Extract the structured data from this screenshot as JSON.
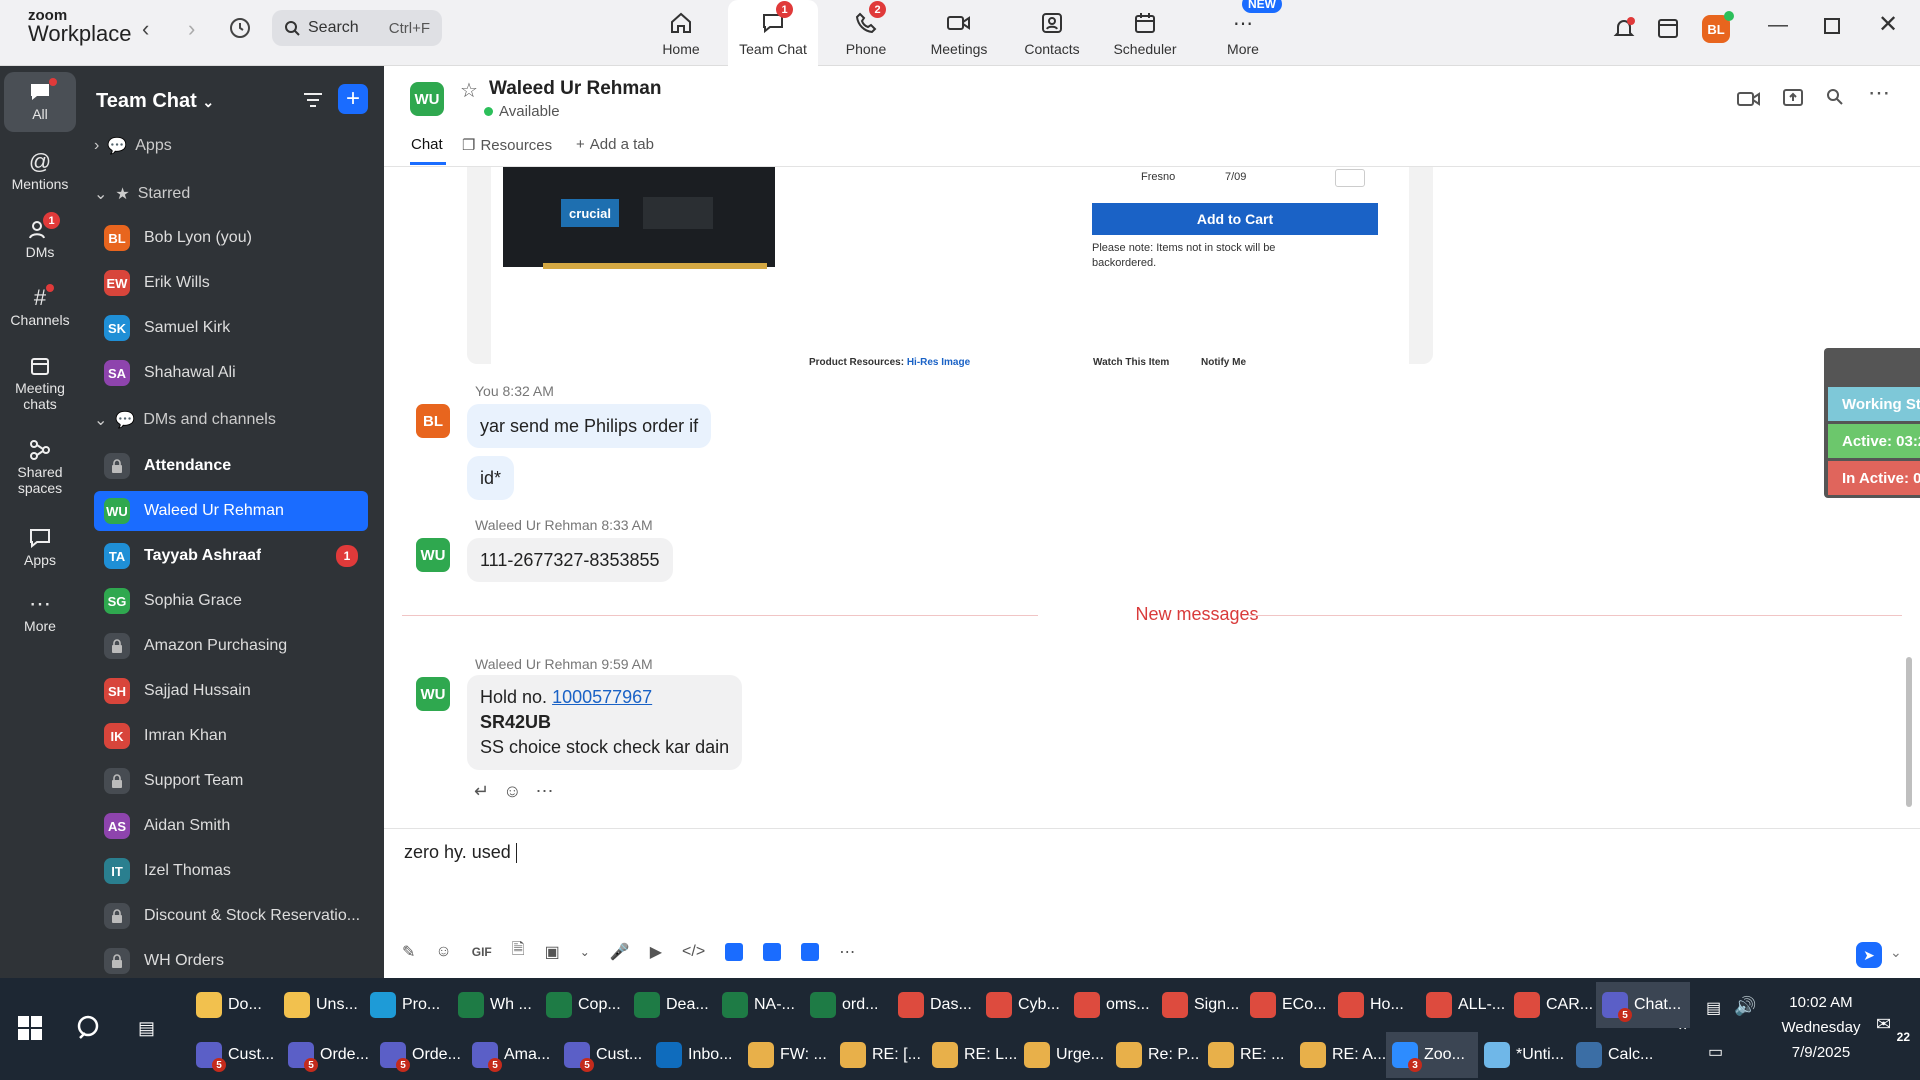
{
  "app": {
    "brand_top": "zoom",
    "brand_bottom": "Workplace"
  },
  "search": {
    "label": "Search",
    "shortcut": "Ctrl+F"
  },
  "nav_tabs": [
    {
      "label": "Home",
      "icon": "home-icon",
      "badge": ""
    },
    {
      "label": "Team Chat",
      "icon": "chat-icon",
      "badge": "1"
    },
    {
      "label": "Phone",
      "icon": "phone-icon",
      "badge": "2"
    },
    {
      "label": "Meetings",
      "icon": "video-icon",
      "badge": ""
    },
    {
      "label": "Contacts",
      "icon": "contacts-icon",
      "badge": ""
    },
    {
      "label": "Scheduler",
      "icon": "calendar-icon",
      "badge": ""
    },
    {
      "label": "More",
      "icon": "more-icon",
      "badge": "NEW"
    }
  ],
  "user_avatar": "BL",
  "rail": [
    {
      "label": "All",
      "icon": "chat-bubble-icon"
    },
    {
      "label": "Mentions",
      "icon": "at-icon"
    },
    {
      "label": "DMs",
      "icon": "people-icon",
      "badge": "1"
    },
    {
      "label": "Channels",
      "icon": "hash-icon"
    },
    {
      "label": "Meeting chats",
      "icon": "calendar-icon"
    },
    {
      "label": "Shared spaces",
      "icon": "share-icon"
    },
    {
      "label": "Apps",
      "icon": "apps-icon"
    },
    {
      "label": "More",
      "icon": "more-icon"
    }
  ],
  "sidebar": {
    "title": "Team Chat",
    "apps_label": "Apps",
    "starred_label": "Starred",
    "dms_label": "DMs and channels",
    "starred": [
      {
        "initials": "BL",
        "name": "Bob Lyon (you)",
        "color": "#e8651e"
      },
      {
        "initials": "EW",
        "name": "Erik Wills",
        "color": "#d8453b"
      },
      {
        "initials": "SK",
        "name": "Samuel Kirk",
        "color": "#1f8fd6"
      },
      {
        "initials": "SA",
        "name": "Shahawal Ali",
        "color": "#8e44ad"
      }
    ],
    "channels": [
      {
        "initials": "",
        "name": "Attendance",
        "lock": true,
        "bold": true
      },
      {
        "initials": "WU",
        "name": "Waleed Ur Rehman",
        "color": "#2fa84f",
        "selected": true
      },
      {
        "initials": "TA",
        "name": "Tayyab Ashraaf",
        "color": "#1f8fd6",
        "bold": true,
        "count": "1"
      },
      {
        "initials": "SG",
        "name": "Sophia Grace",
        "color": "#2fa84f"
      },
      {
        "initials": "",
        "name": "Amazon Purchasing",
        "lock": true
      },
      {
        "initials": "SH",
        "name": "Sajjad Hussain",
        "color": "#d8453b"
      },
      {
        "initials": "IK",
        "name": "Imran Khan",
        "color": "#d8453b"
      },
      {
        "initials": "",
        "name": "Support Team",
        "lock": true
      },
      {
        "initials": "AS",
        "name": "Aidan Smith",
        "color": "#8e44ad"
      },
      {
        "initials": "IT",
        "name": "Izel Thomas",
        "color": "#2a7f8f"
      },
      {
        "initials": "",
        "name": "Discount & Stock Reservatio...",
        "lock": true
      },
      {
        "initials": "",
        "name": "WH Orders",
        "lock": true
      }
    ]
  },
  "conversation": {
    "initials": "WU",
    "name": "Waleed Ur Rehman",
    "status": "Available",
    "tabs": [
      "Chat",
      "Resources",
      "Add a tab"
    ]
  },
  "preview": {
    "location": "Fresno",
    "date": "7/09",
    "add_to_cart": "Add to Cart",
    "note": "Please note: Items not in stock will be backordered.",
    "brand": "crucial",
    "resources": "Product Resources:",
    "hires": "Hi-Res Image",
    "watch": "Watch This Item",
    "notify": "Notify Me"
  },
  "messages": [
    {
      "sender": "You",
      "time": "8:32 AM",
      "initials": "BL",
      "lines": [
        "yar send me Philips order if",
        "id*"
      ]
    },
    {
      "sender": "Waleed Ur Rehman",
      "time": "8:33 AM",
      "initials": "WU",
      "lines": [
        "111-2677327-8353855"
      ]
    },
    {
      "sender": "Waleed Ur Rehman",
      "time": "9:59 AM",
      "initials": "WU",
      "hold_prefix": "Hold no.",
      "hold_link": "1000577967",
      "bold_line": "SR42UB",
      "last_line": "SS choice stock check kar dain"
    }
  ],
  "new_messages_label": "New messages",
  "composer": {
    "text": "zero hy. used "
  },
  "status_widget": [
    {
      "label": "Working St",
      "color": "#7ec8d8"
    },
    {
      "label": "Active: 03:2",
      "color": "#6cc76c"
    },
    {
      "label": "In Active: 0",
      "color": "#e0655c"
    }
  ],
  "taskbar": {
    "row1": [
      {
        "label": "Do...",
        "icon": "folder-icon",
        "color": "#f2c14e"
      },
      {
        "label": "Uns...",
        "icon": "folder-icon",
        "color": "#f2c14e"
      },
      {
        "label": "Pro...",
        "icon": "edge-icon",
        "color": "#1e9bd7"
      },
      {
        "label": "Wh ...",
        "icon": "excel-icon",
        "color": "#1e7b45"
      },
      {
        "label": "Cop...",
        "icon": "excel-icon",
        "color": "#1e7b45"
      },
      {
        "label": "Dea...",
        "icon": "excel-icon",
        "color": "#1e7b45"
      },
      {
        "label": "NA-...",
        "icon": "excel-icon",
        "color": "#1e7b45"
      },
      {
        "label": "ord...",
        "icon": "excel-icon",
        "color": "#1e7b45"
      },
      {
        "label": "Das...",
        "icon": "chrome-icon",
        "color": "#dd4b3e"
      },
      {
        "label": "Cyb...",
        "icon": "chrome-icon",
        "color": "#dd4b3e"
      },
      {
        "label": "oms...",
        "icon": "chrome-icon",
        "color": "#dd4b3e"
      },
      {
        "label": "Sign...",
        "icon": "chrome-icon",
        "color": "#dd4b3e"
      },
      {
        "label": "ECo...",
        "icon": "chrome-icon",
        "color": "#dd4b3e"
      },
      {
        "label": "Ho...",
        "icon": "chrome-icon",
        "color": "#dd4b3e"
      },
      {
        "label": "ALL-...",
        "icon": "chrome-icon",
        "color": "#dd4b3e"
      },
      {
        "label": "CAR...",
        "icon": "chrome-icon",
        "color": "#dd4b3e"
      },
      {
        "label": "Chat...",
        "icon": "teams-icon",
        "color": "#5b5fc7",
        "count": "5",
        "active": true
      }
    ],
    "row2": [
      {
        "label": "Cust...",
        "icon": "teams-icon",
        "color": "#5b5fc7",
        "count": "5"
      },
      {
        "label": "Orde...",
        "icon": "teams-icon",
        "color": "#5b5fc7",
        "count": "5"
      },
      {
        "label": "Orde...",
        "icon": "teams-icon",
        "color": "#5b5fc7",
        "count": "5"
      },
      {
        "label": "Ama...",
        "icon": "teams-icon",
        "color": "#5b5fc7",
        "count": "5"
      },
      {
        "label": "Cust...",
        "icon": "teams-icon",
        "color": "#5b5fc7",
        "count": "5"
      },
      {
        "label": "Inbo...",
        "icon": "outlook-icon",
        "color": "#0f6cbd"
      },
      {
        "label": "FW: ...",
        "icon": "mail-icon",
        "color": "#e8b04a"
      },
      {
        "label": "RE: [...",
        "icon": "mail-icon",
        "color": "#e8b04a"
      },
      {
        "label": "RE: L...",
        "icon": "mail-icon",
        "color": "#e8b04a"
      },
      {
        "label": "Urge...",
        "icon": "mail-icon",
        "color": "#e8b04a"
      },
      {
        "label": "Re: P...",
        "icon": "mail-icon",
        "color": "#e8b04a"
      },
      {
        "label": "RE: ...",
        "icon": "mail-icon",
        "color": "#e8b04a"
      },
      {
        "label": "RE: A...",
        "icon": "mail-icon",
        "color": "#e8b04a"
      },
      {
        "label": "Zoo...",
        "icon": "zoom-icon",
        "color": "#2d8cff",
        "count": "3",
        "active": true
      },
      {
        "label": "*Unti...",
        "icon": "notepad-icon",
        "color": "#6fb7e8"
      },
      {
        "label": "Calc...",
        "icon": "calculator-icon",
        "color": "#3b6ea5"
      }
    ],
    "time": "10:02 AM",
    "day": "Wednesday",
    "date": "7/9/2025",
    "notif_count": "22"
  }
}
